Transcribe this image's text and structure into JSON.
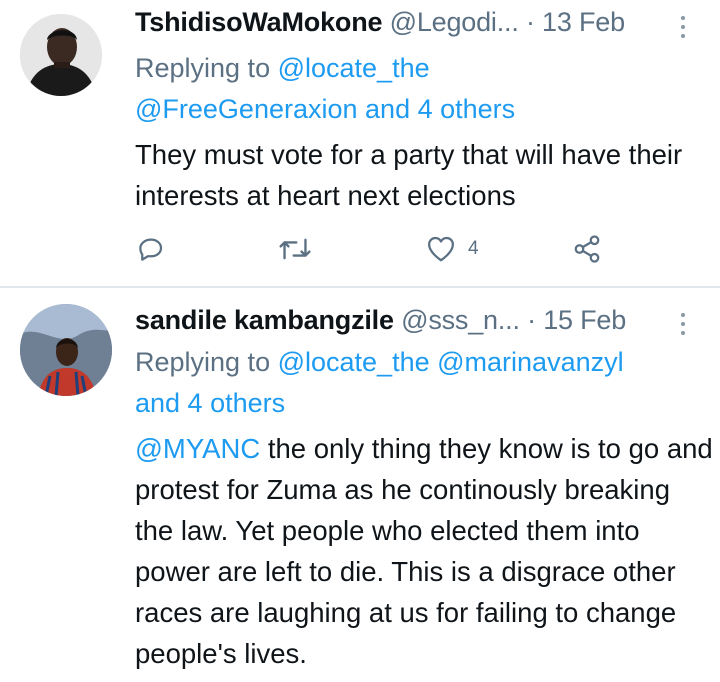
{
  "tweets": [
    {
      "display_name": "TshidisoWaMokone",
      "handle": "@Legodi...",
      "separator": "·",
      "date": "13 Feb",
      "replying_prefix": "Replying to ",
      "replying_mentions": [
        "@locate_the",
        "@FreeGeneraxion"
      ],
      "replying_others": "and 4 others",
      "text": "They must vote for a party that will have their interests at heart next elections",
      "actions": {
        "reply_icon": "reply-icon",
        "retweet_icon": "retweet-icon",
        "like_icon": "heart-icon",
        "like_count": "4",
        "share_icon": "share-icon"
      }
    },
    {
      "display_name": "sandile kambangzile",
      "handle": "@sss_n...",
      "separator": "·",
      "date": "15 Feb",
      "replying_prefix": "Replying to ",
      "replying_mentions": [
        "@locate_the",
        "@marinavanzyl"
      ],
      "replying_others": "and 4 others",
      "text_mention": "@MYANC",
      "text": " the only thing they know is to go and protest for Zuma as he continously breaking the law. Yet people who elected them into power  are left to die. This is a disgrace other races are laughing at us for failing to change people's lives."
    }
  ],
  "colors": {
    "mention": "#1d9bf0",
    "secondary_text": "#5b7083",
    "divider": "#e1e8ed",
    "icon": "#5b7083"
  }
}
